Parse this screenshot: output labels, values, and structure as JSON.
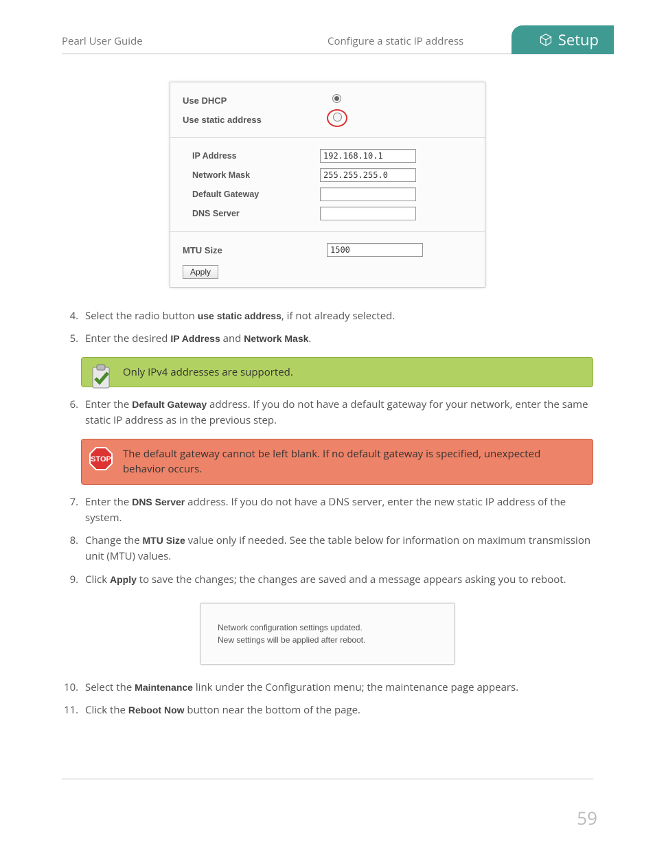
{
  "header": {
    "left": "Pearl User Guide",
    "center": "Configure a static IP address",
    "tab": "Setup"
  },
  "net_panel": {
    "use_dhcp_label": "Use DHCP",
    "use_static_label": "Use static address",
    "ip_label": "IP Address",
    "ip_value": "192.168.10.1",
    "mask_label": "Network Mask",
    "mask_value": "255.255.255.0",
    "gw_label": "Default Gateway",
    "gw_value": "",
    "dns_label": "DNS Server",
    "dns_value": "",
    "mtu_label": "MTU Size",
    "mtu_value": "1500",
    "apply_label": "Apply"
  },
  "steps": {
    "s4_a": "Select the radio button ",
    "s4_b": "use static address",
    "s4_c": ", if not already selected.",
    "s5_a": "Enter the desired ",
    "s5_b": "IP Address",
    "s5_c": " and ",
    "s5_d": "Network Mask",
    "s5_e": ".",
    "tip": "Only IPv4 addresses are supported.",
    "s6_a": "Enter the ",
    "s6_b": "Default Gateway",
    "s6_c": " address. If you do not have a default gateway for your network, enter the same static IP address as in the previous step.",
    "warn": "The default gateway cannot be left blank. If no default gateway is specified, unexpected behavior occurs.",
    "s7_a": "Enter the ",
    "s7_b": "DNS Server",
    "s7_c": " address. If you do not have a DNS server, enter the new static IP address of the system.",
    "s8_a": "Change the ",
    "s8_b": "MTU Size",
    "s8_c": " value only if needed. See the table below for information on maximum transmission unit (MTU) values.",
    "s9_a": "Click ",
    "s9_b": "Apply",
    "s9_c": " to save the changes; the changes are saved and a message appears asking you to reboot.",
    "msg_line1": "Network configuration settings updated.",
    "msg_line2": "New settings will be applied after reboot.",
    "s10_a": "Select the ",
    "s10_b": "Maintenance",
    "s10_c": " link under the Configuration menu; the maintenance page appears.",
    "s11_a": "Click the ",
    "s11_b": "Reboot Now",
    "s11_c": " button near the bottom of the page."
  },
  "page_number": "59"
}
